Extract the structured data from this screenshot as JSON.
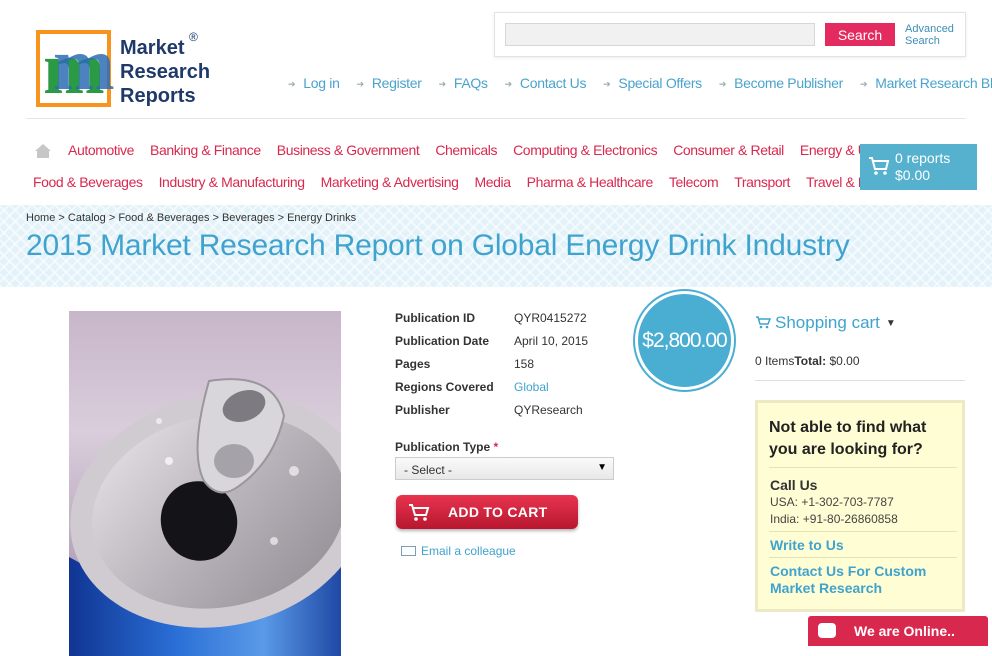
{
  "logo": {
    "line1": "Market",
    "line2": "Research",
    "line3": "Reports",
    "reg": "®"
  },
  "search": {
    "placeholder": "",
    "button": "Search",
    "advanced_line1": "Advanced",
    "advanced_line2": "Search"
  },
  "toplinks": [
    "Log in",
    "Register",
    "FAQs",
    "Contact Us",
    "Special Offers",
    "Become Publisher",
    "Market Research Blog"
  ],
  "categories_row1": [
    "Automotive",
    "Banking & Finance",
    "Business & Government",
    "Chemicals",
    "Computing & Electronics",
    "Consumer & Retail",
    "Energy & Utilities"
  ],
  "categories_row2": [
    "Food & Beverages",
    "Industry & Manufacturing",
    "Marketing & Advertising",
    "Media",
    "Pharma & Healthcare",
    "Telecom",
    "Transport",
    "Travel & Leisure"
  ],
  "cart": {
    "count": "0 reports",
    "total": "$0.00"
  },
  "breadcrumb": "Home > Catalog > Food & Beverages > Beverages > Energy Drinks",
  "title": "2015 Market Research Report on Global Energy Drink Industry",
  "details": {
    "pub_id_label": "Publication ID",
    "pub_id": "QYR0415272",
    "pub_date_label": "Publication Date",
    "pub_date": "April 10, 2015",
    "pages_label": "Pages",
    "pages": "158",
    "regions_label": "Regions Covered",
    "regions": "Global",
    "publisher_label": "Publisher",
    "publisher": "QYResearch"
  },
  "price": "$2,800.00",
  "pub_type": {
    "label": "Publication Type",
    "required": "*",
    "selected": "- Select -"
  },
  "add_to_cart": "ADD TO CART",
  "email_colleague": "Email a colleague",
  "shopping_cart": {
    "title": "Shopping cart",
    "items": "0 Items",
    "total_label": "Total:",
    "total": "$0.00"
  },
  "help": {
    "title": "Not able to find what you are looking for?",
    "call_us": "Call Us",
    "usa": "USA: +1-302-703-7787",
    "india": "India: +91-80-26860858",
    "write": "Write to Us",
    "custom": "Contact Us For Custom Market Research"
  },
  "chat": "We are Online..",
  "colors": {
    "accent_pink": "#d9284e",
    "accent_blue": "#3fa3cf",
    "cart_blue": "#56b1cf"
  }
}
